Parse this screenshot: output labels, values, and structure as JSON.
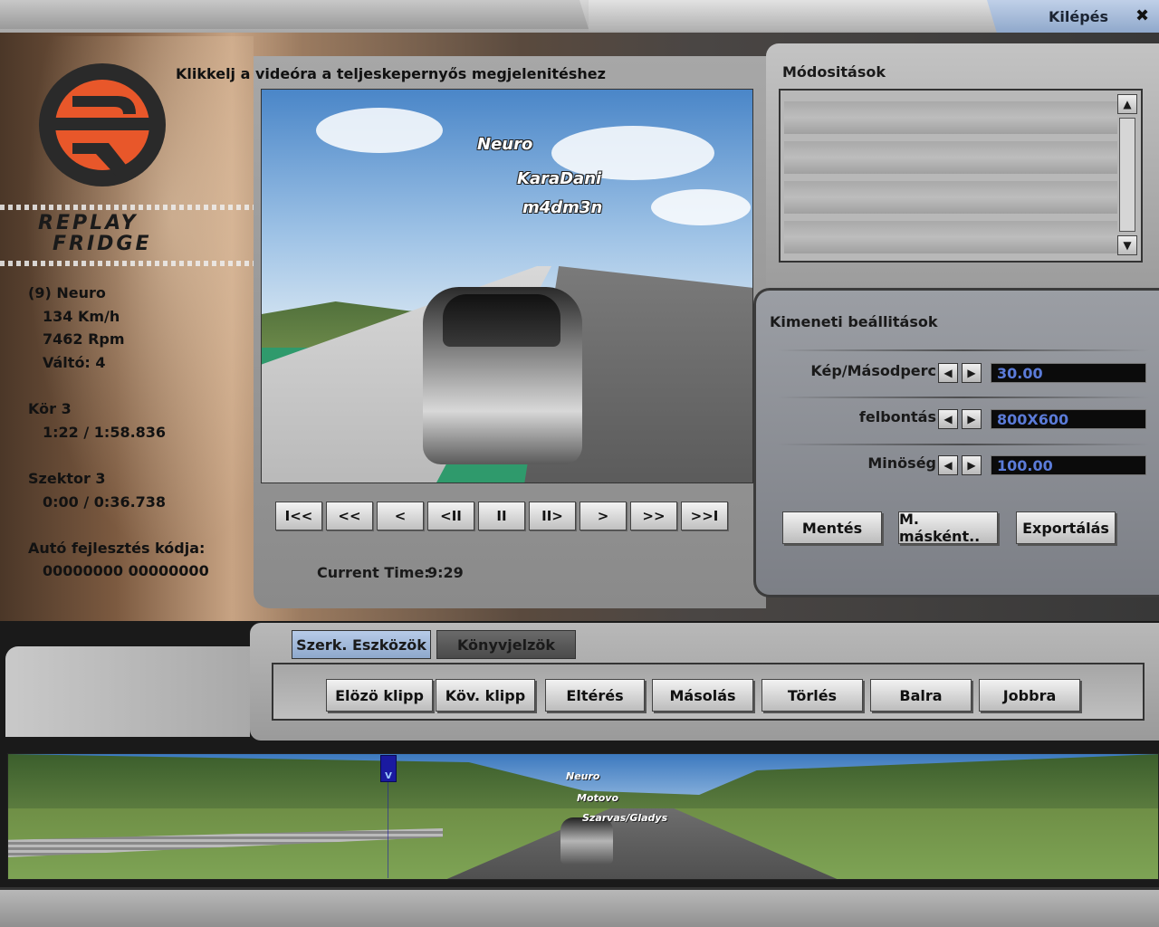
{
  "header": {
    "exit_label": "Kilépés",
    "exit_icon": "close-icon"
  },
  "logo": {
    "line1": "REPLAY",
    "line2": "FRIDGE",
    "brand_color": "#e8572a"
  },
  "stats": {
    "driver": "(9) Neuro",
    "speed": "134 Km/h",
    "rpm": "7462 Rpm",
    "gear": "Váltó: 4",
    "lap_label": "Kör 3",
    "lap_time": "1:22 / 1:58.836",
    "sector_label": "Szektor 3",
    "sector_time": "0:00 / 0:36.738",
    "code_label": "Autó fejlesztés kódja:",
    "code_value": "00000000 00000000"
  },
  "video": {
    "hint": "Klikkelj a videóra a teljeskepernyős megjelenitéshez",
    "driver_tags": [
      "Neuro",
      "KaraDani",
      "m4dm3n"
    ],
    "controls": [
      {
        "name": "skip-start",
        "glyph": "I<<"
      },
      {
        "name": "rewind",
        "glyph": "<<"
      },
      {
        "name": "step-back",
        "glyph": "<"
      },
      {
        "name": "frame-back",
        "glyph": "<II"
      },
      {
        "name": "pause",
        "glyph": "II"
      },
      {
        "name": "frame-forward",
        "glyph": "II>"
      },
      {
        "name": "step-forward",
        "glyph": ">"
      },
      {
        "name": "fast-forward",
        "glyph": ">>"
      },
      {
        "name": "skip-end",
        "glyph": ">>I"
      }
    ],
    "current_time_label": "Current Time:",
    "current_time_value": "9:29"
  },
  "mods": {
    "title": "Módositások",
    "rows": 4
  },
  "output": {
    "title": "Kimeneti beállitások",
    "settings": [
      {
        "label": "Kép/Másodperc",
        "value": "30.00"
      },
      {
        "label": "felbontás",
        "value": "800X600"
      },
      {
        "label": "Minöség",
        "value": "100.00"
      }
    ],
    "buttons": [
      "Mentés",
      "M. másként..",
      "Exportálás"
    ]
  },
  "tools": {
    "tabs": [
      {
        "label": "Szerk. Eszközök",
        "active": true
      },
      {
        "label": "Könyvjelzök",
        "active": false
      }
    ],
    "clip_buttons": [
      "Elözö klipp",
      "Köv. klipp",
      "Eltérés",
      "Másolás",
      "Törlés",
      "Balra",
      "Jobbra"
    ]
  },
  "timeline": {
    "marker": "V",
    "tags": [
      "Neuro",
      "Motovo",
      "Szarvas/Gladys"
    ]
  }
}
